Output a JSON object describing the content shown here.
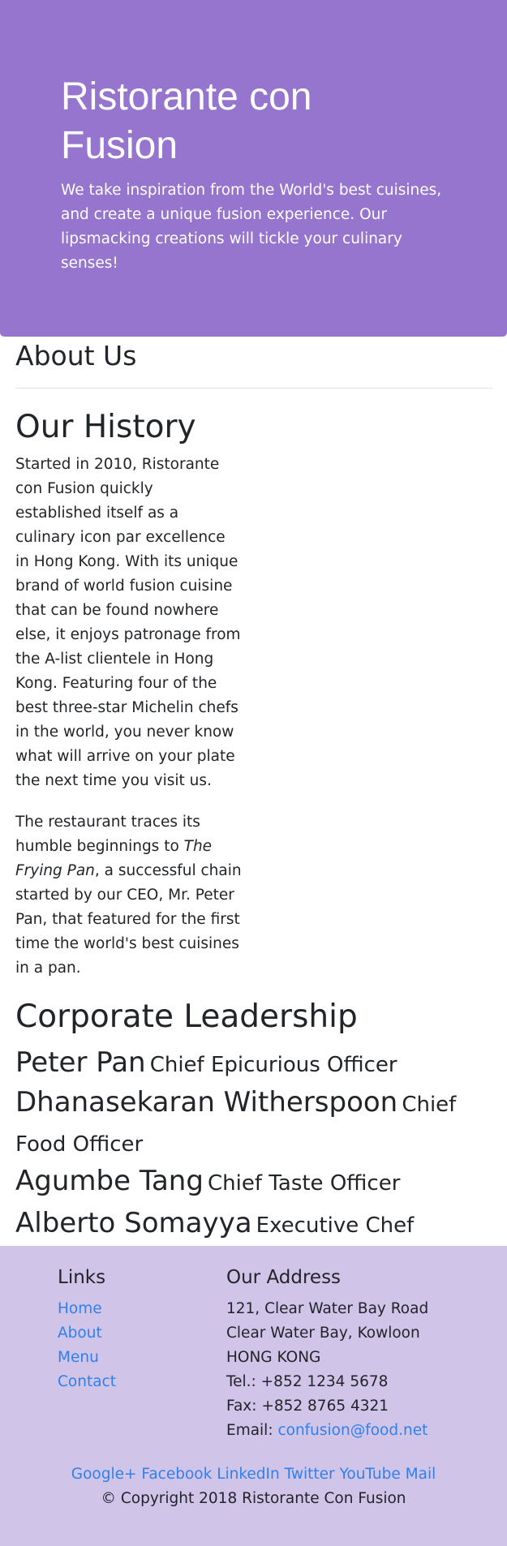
{
  "jumbotron": {
    "title": "Ristorante con Fusion",
    "tagline": "We take inspiration from the World's best cuisines, and create a unique fusion experience. Our lipsmacking creations will tickle your culinary senses!"
  },
  "about": {
    "title": "About Us"
  },
  "history": {
    "title": "Our History",
    "paragraph1": "Started in 2010, Ristorante con Fusion quickly established itself as a culinary icon par excellence in Hong Kong. With its unique brand of world fusion cuisine that can be found nowhere else, it enjoys patronage from the A-list clientele in Hong Kong. Featuring four of the best three-star Michelin chefs in the world, you never know what will arrive on your plate the next time you visit us.",
    "paragraph2_start": "The restaurant traces its humble beginnings to ",
    "paragraph2_italic": "The Frying Pan",
    "paragraph2_end": ", a successful chain started by our CEO, Mr. Peter Pan, that featured for the first time the world's best cuisines in a pan."
  },
  "leadership": {
    "title": "Corporate Leadership",
    "leaders": [
      {
        "name": "Peter Pan",
        "role": "Chief Epicurious Officer"
      },
      {
        "name": "Dhanasekaran Witherspoon",
        "role": "Chief Food Officer"
      },
      {
        "name": "Agumbe Tang",
        "role": "Chief Taste Officer"
      },
      {
        "name": "Alberto Somayya",
        "role": "Executive Chef"
      }
    ]
  },
  "footer": {
    "links_title": "Links",
    "links": [
      "Home",
      "About",
      "Menu",
      "Contact"
    ],
    "address_title": "Our Address",
    "address_lines": [
      "121, Clear Water Bay Road",
      "Clear Water Bay, Kowloon",
      "HONG KONG",
      "Tel.: +852 1234 5678",
      "Fax: +852 8765 4321"
    ],
    "email_label": "Email: ",
    "email": "confusion@food.net",
    "social": [
      "Google+",
      "Facebook",
      "LinkedIn",
      "Twitter",
      "YouTube",
      "Mail"
    ],
    "copyright": "© Copyright 2018 Ristorante Con Fusion"
  },
  "colors": {
    "jumbotron_bg": "#9575cd",
    "footer_bg": "#d1c4e9",
    "link": "#2f80ed"
  }
}
